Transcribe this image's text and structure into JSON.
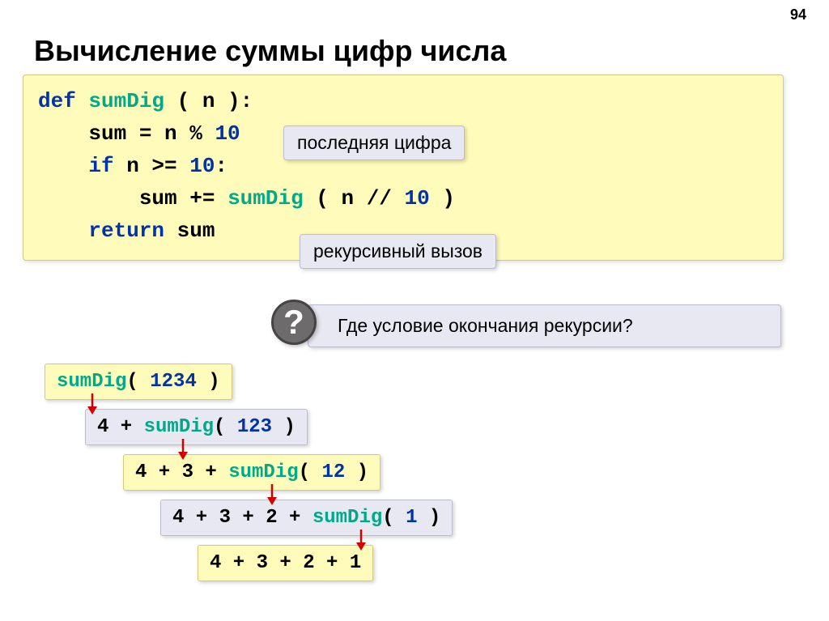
{
  "page_number": "94",
  "title": "Вычисление суммы цифр числа",
  "code": {
    "line1": {
      "kw": "def",
      "fn": "sumDig",
      "text1": " ( n ):"
    },
    "line2": {
      "var": "    sum",
      "eq": " = n % ",
      "num": "10"
    },
    "line3": {
      "kw": "    if",
      "cond": " n >= ",
      "num": "10",
      "col": ":"
    },
    "line4": {
      "var": "        sum",
      "op": " += ",
      "fn": "sumDig",
      "text1": " ( n // ",
      "num": "10",
      "text2": " )"
    },
    "line5": {
      "kw": "    return",
      "var": " sum"
    }
  },
  "callout1": "последняя цифра",
  "callout2": "рекурсивный вызов",
  "question": "Где условие окончания рекурсии?",
  "steps": {
    "s1": {
      "fn": "sumDig",
      "p1": "( ",
      "num": "1234",
      "p2": " )"
    },
    "s2": {
      "t1": "4 + ",
      "fn": "sumDig",
      "p1": "( ",
      "num": "123",
      "p2": " )"
    },
    "s3": {
      "t1": "4 + 3 + ",
      "fn": "sumDig",
      "p1": "( ",
      "num": "12",
      "p2": " )"
    },
    "s4": {
      "t1": "4 + 3 + 2 + ",
      "fn": "sumDig",
      "p1": "( ",
      "num": "1",
      "p2": " )"
    },
    "s5": {
      "t1": "4 + 3 + 2 + 1"
    }
  }
}
